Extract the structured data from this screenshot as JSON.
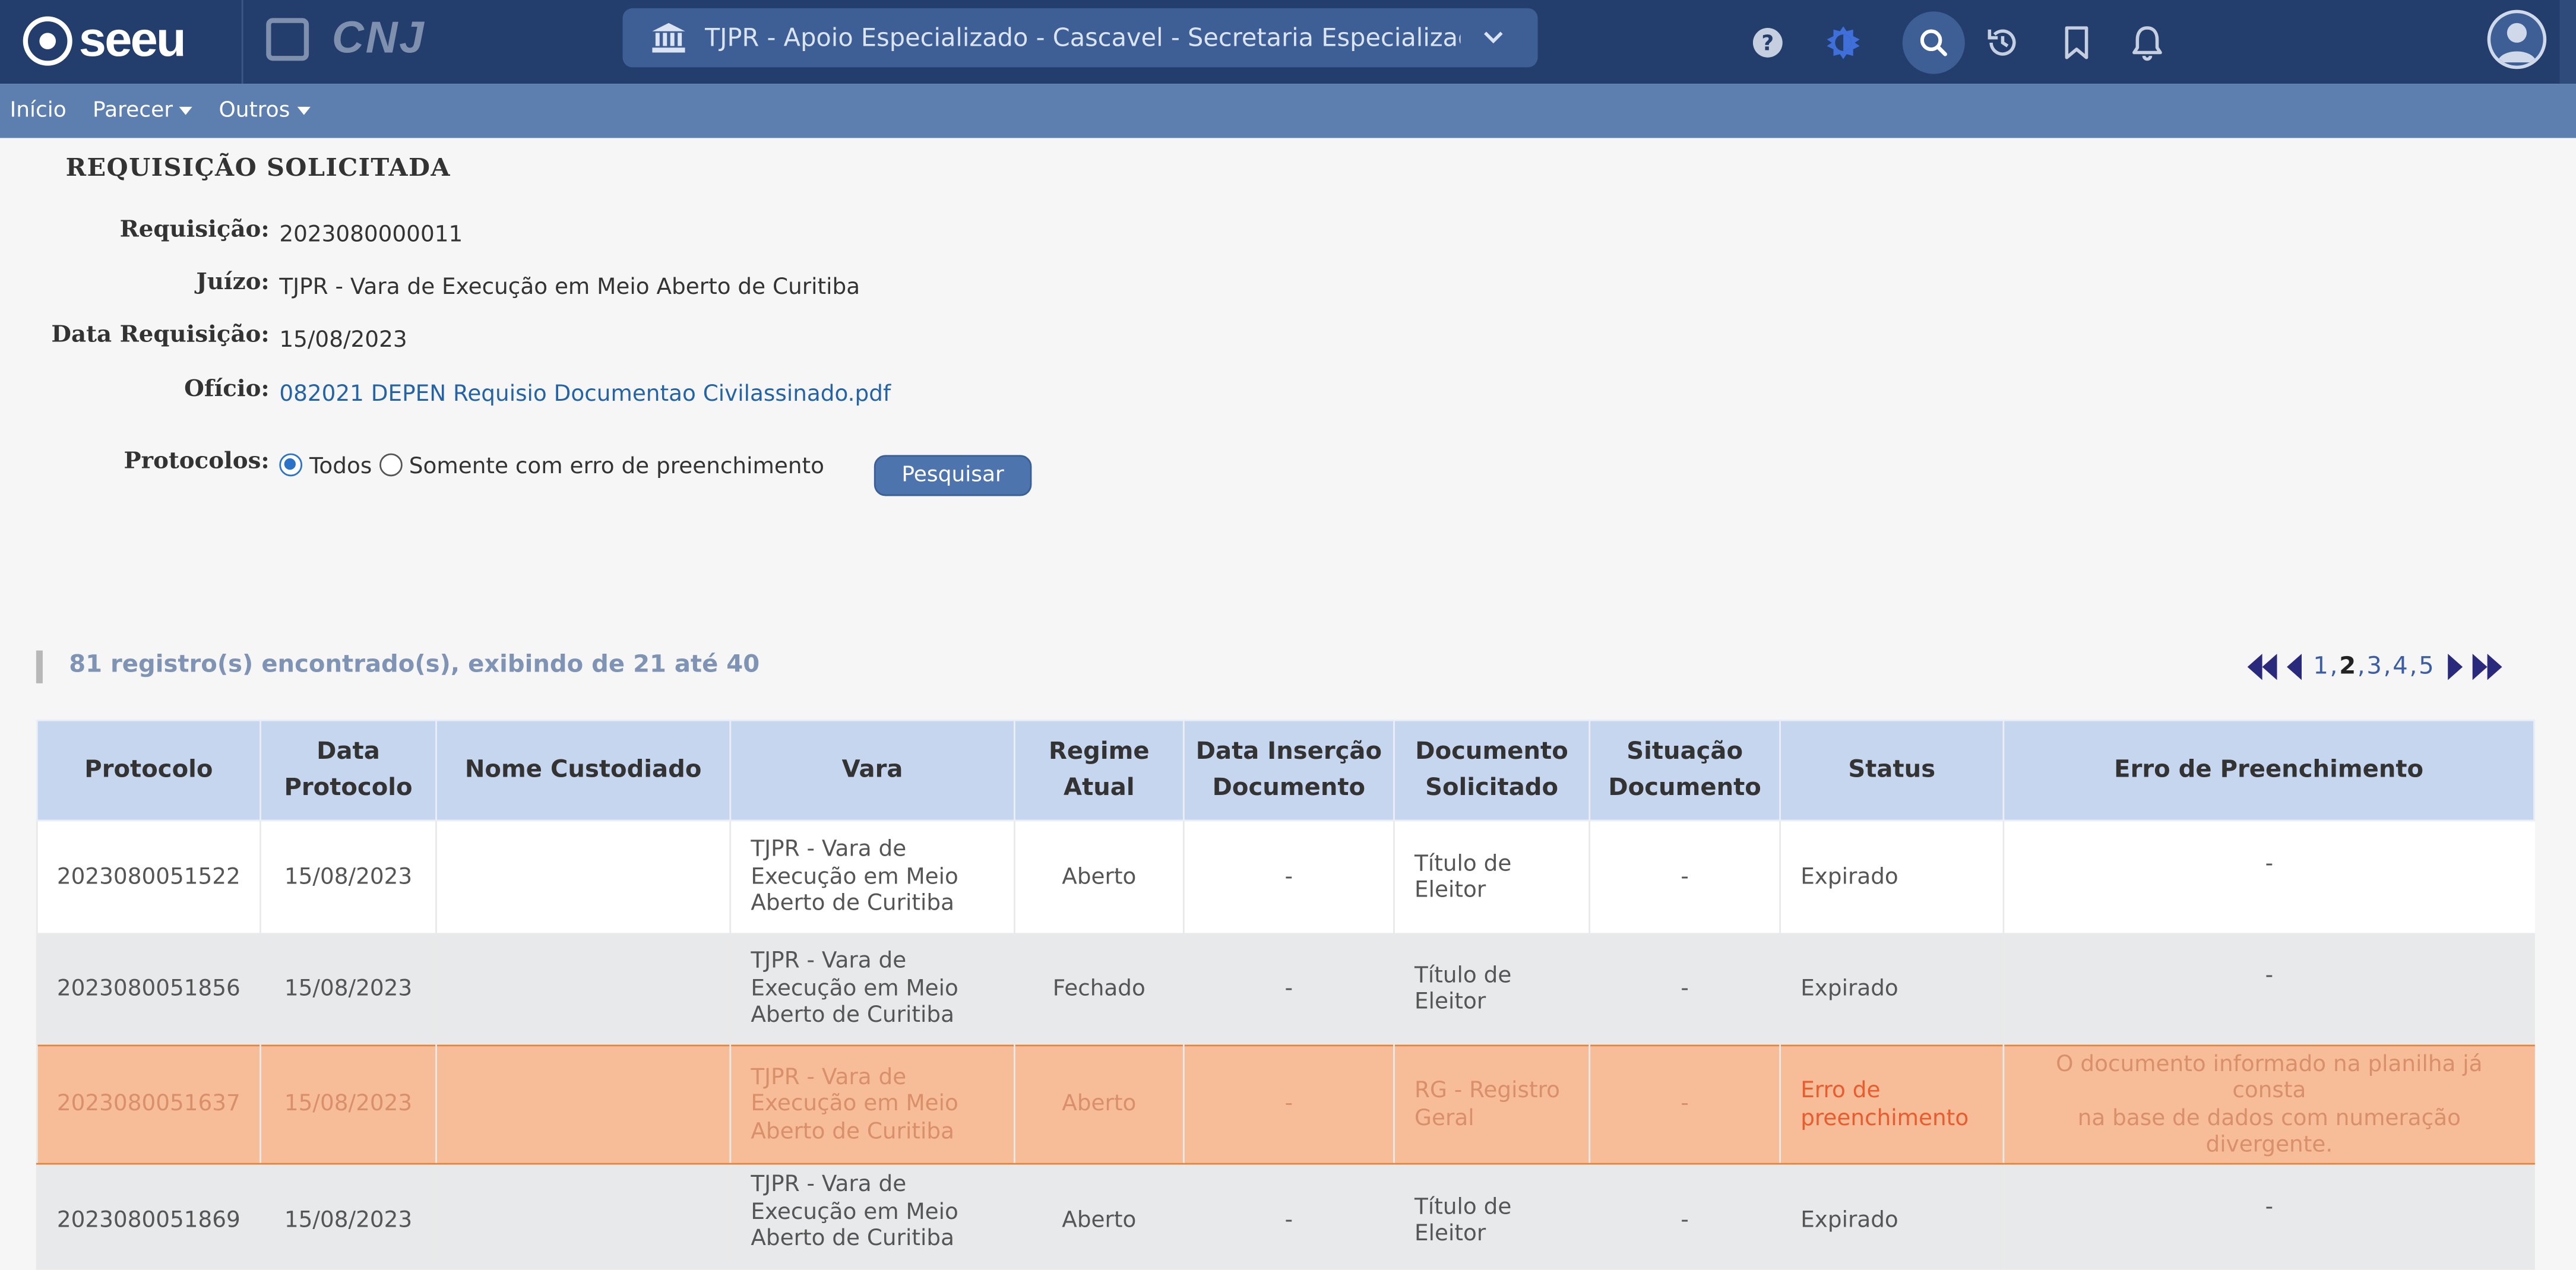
{
  "app": {
    "logo_text": "seeu",
    "partner_logo_text": "CNJ"
  },
  "header": {
    "court_selector": "TJPR - Apoio Especializado - Cascavel - Secretaria Especializad...",
    "icons": [
      "help-icon",
      "theme-icon",
      "search-icon",
      "history-icon",
      "bookmark-icon",
      "bell-icon",
      "user-avatar-icon"
    ]
  },
  "menu": {
    "items": [
      {
        "label": "Início"
      },
      {
        "label": "Parecer"
      },
      {
        "label": "Outros"
      }
    ]
  },
  "requisicao": {
    "title": "REQUISIÇÃO SOLICITADA",
    "fields": [
      {
        "label": "Requisição:",
        "value": "2023080000011"
      },
      {
        "label": "Juízo:",
        "value": "TJPR - Vara de Execução em Meio Aberto de Curitiba"
      },
      {
        "label": "Data Requisição:",
        "value": "15/08/2023"
      },
      {
        "label": "Ofício:",
        "value": "082021 DEPEN Requisio Documentao Civilassinado.pdf"
      }
    ],
    "protocolos_label": "Protocolos:",
    "radio_todos": "Todos",
    "radio_erro": "Somente com erro de preenchimento",
    "search_button": "Pesquisar"
  },
  "results": {
    "summary": "81 registro(s) encontrado(s), exibindo de 21 até 40",
    "pages": [
      "1",
      "2",
      "3",
      "4",
      "5"
    ],
    "current_page": "2"
  },
  "table": {
    "headers": {
      "protocolo": "Protocolo",
      "data_protocolo_1": "Data",
      "data_protocolo_2": "Protocolo",
      "nome": "Nome Custodiado",
      "vara": "Vara",
      "regime_1": "Regime",
      "regime_2": "Atual",
      "insercao_1": "Data Inserção",
      "insercao_2": "Documento",
      "documento_1": "Documento",
      "documento_2": "Solicitado",
      "situacao_1": "Situação",
      "situacao_2": "Documento",
      "status": "Status",
      "erro": "Erro de Preenchimento"
    },
    "rows": [
      {
        "protocolo": "2023080051522",
        "data": "15/08/2023",
        "nome": "",
        "vara_1": "TJPR - Vara de",
        "vara_2": "Execução em Meio",
        "vara_3": "Aberto de Curitiba",
        "regime": "Aberto",
        "insercao": "-",
        "doc_1": "Título de",
        "doc_2": "Eleitor",
        "situacao": "-",
        "status_1": "Expirado",
        "status_2": "",
        "erro_1": "-",
        "erro_2": "",
        "erro_3": ""
      },
      {
        "protocolo": "2023080051856",
        "data": "15/08/2023",
        "nome": "",
        "vara_1": "TJPR - Vara de",
        "vara_2": "Execução em Meio",
        "vara_3": "Aberto de Curitiba",
        "regime": "Fechado",
        "insercao": "-",
        "doc_1": "Título de",
        "doc_2": "Eleitor",
        "situacao": "-",
        "status_1": "Expirado",
        "status_2": "",
        "erro_1": "-",
        "erro_2": "",
        "erro_3": ""
      },
      {
        "protocolo": "2023080051637",
        "data": "15/08/2023",
        "nome": "",
        "vara_1": "TJPR - Vara de",
        "vara_2": "Execução em Meio",
        "vara_3": "Aberto de Curitiba",
        "regime": "Aberto",
        "insercao": "-",
        "doc_1": "RG - Registro",
        "doc_2": "Geral",
        "situacao": "-",
        "status_1": "Erro de",
        "status_2": "preenchimento",
        "erro_1": "O documento informado na planilha já consta",
        "erro_2": "na base de dados com numeração",
        "erro_3": "divergente."
      },
      {
        "protocolo": "2023080051869",
        "data": "15/08/2023",
        "nome": "",
        "vara_1": "TJPR - Vara de",
        "vara_2": "Execução em Meio",
        "vara_3": "Aberto de Curitiba",
        "regime": "Aberto",
        "insercao": "-",
        "doc_1": "Título de",
        "doc_2": "Eleitor",
        "situacao": "-",
        "status_1": "Expirado",
        "status_2": "",
        "erro_1": "-",
        "erro_2": "",
        "erro_3": ""
      }
    ]
  },
  "colors": {
    "header_bg": "#233e6c",
    "menu_bg": "#5d7fb0",
    "table_head_bg": "#c7d6ef",
    "error_row_bg": "#f7bd98",
    "error_text": "#ea5b2e"
  }
}
